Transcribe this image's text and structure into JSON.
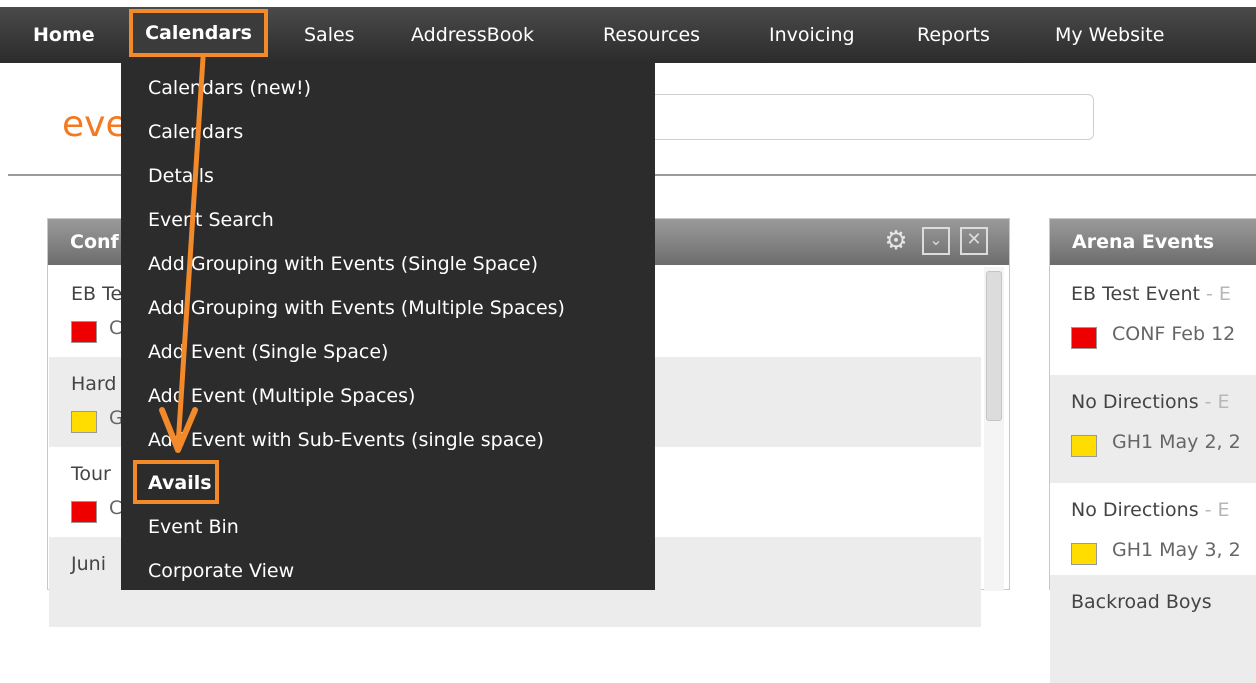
{
  "nav": {
    "items": [
      {
        "label": "Home"
      },
      {
        "label": "Calendars"
      },
      {
        "label": "Sales"
      },
      {
        "label": "AddressBook"
      },
      {
        "label": "Resources"
      },
      {
        "label": "Invoicing"
      },
      {
        "label": "Reports"
      },
      {
        "label": "My Website"
      }
    ],
    "active": "Calendars"
  },
  "brand": {
    "logo_fragment": "eve"
  },
  "dropdown": {
    "items": [
      {
        "label": "Calendars (new!)"
      },
      {
        "label": "Calendars"
      },
      {
        "label": "Details"
      },
      {
        "label": "Event Search"
      },
      {
        "label": "Add Grouping with Events (Single Space)"
      },
      {
        "label": "Add Grouping with Events (Multiple Spaces)"
      },
      {
        "label": "Add Event (Single Space)"
      },
      {
        "label": "Add Event (Multiple Spaces)"
      },
      {
        "label": "Add Event with Sub-Events (single space)"
      },
      {
        "label": "Avails"
      },
      {
        "label": "Event Bin"
      },
      {
        "label": "Corporate View"
      }
    ],
    "highlighted": "Avails"
  },
  "left_panel": {
    "title": "Conf",
    "rows": [
      {
        "name": "EB Te",
        "code": "C",
        "color": "#ee0000"
      },
      {
        "name": "Hard",
        "code": "G",
        "color": "#ffdd00"
      },
      {
        "name": "Tour",
        "code": "C",
        "color": "#ee0000"
      },
      {
        "name": "Juni",
        "code": "",
        "color": ""
      }
    ]
  },
  "right_panel": {
    "title": "Arena Events",
    "rows": [
      {
        "name": "EB Test Event",
        "dash": " - E",
        "code": "CONF  Feb 12",
        "color": "#ee0000"
      },
      {
        "name": "No Directions",
        "dash": " - E",
        "code": "GH1  May 2, 2",
        "color": "#ffdd00"
      },
      {
        "name": "No Directions",
        "dash": " - E",
        "code": "GH1  May 3, 2",
        "color": "#ffdd00"
      },
      {
        "name": "Backroad Boys",
        "dash": "",
        "code": "",
        "color": ""
      }
    ]
  },
  "colors": {
    "accent": "#f28a2b",
    "nav_bg": "#2b2b2b",
    "menu_bg": "#2c2c2c",
    "brand": "#f47a20"
  }
}
